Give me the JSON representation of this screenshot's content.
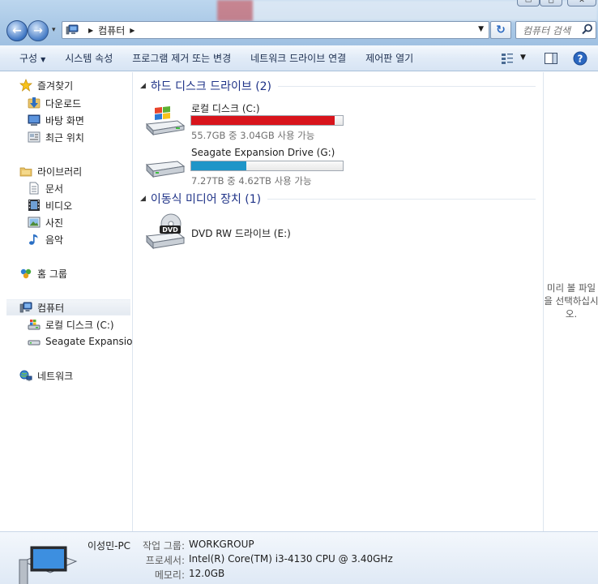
{
  "address": {
    "crumbs": [
      "컴퓨터"
    ]
  },
  "search": {
    "placeholder": "컴퓨터 검색"
  },
  "toolbar": {
    "organize": "구성",
    "system_properties": "시스템 속성",
    "uninstall": "프로그램 제거 또는 변경",
    "map_drive": "네트워크 드라이브 연결",
    "control_panel": "제어판 열기"
  },
  "nav": {
    "favorites": "즐겨찾기",
    "downloads": "다운로드",
    "desktop": "바탕 화면",
    "recent": "최근 위치",
    "libraries": "라이브러리",
    "documents": "문서",
    "videos": "비디오",
    "pictures": "사진",
    "music": "음악",
    "homegroup": "홈 그룹",
    "computer": "컴퓨터",
    "local_disk": "로컬 디스크 (C:)",
    "seagate": "Seagate Expansion I",
    "network": "네트워크"
  },
  "groups": {
    "hdd": "하드 디스크 드라이브 (2)",
    "removable": "이동식 미디어 장치 (1)"
  },
  "drives": [
    {
      "name": "로컬 디스크 (C:)",
      "free_text": "55.7GB 중 3.04GB 사용 가능",
      "used_fraction": 0.945,
      "bar_color": "#d8141c"
    },
    {
      "name": "Seagate Expansion Drive (G:)",
      "free_text": "7.27TB 중 4.62TB 사용 가능",
      "used_fraction": 0.365,
      "bar_color": "#1e95c8"
    },
    {
      "name": "DVD RW 드라이브 (E:)",
      "icon_label": "DVD"
    }
  ],
  "preview": {
    "text": "미리 볼 파일을 선택하십시오."
  },
  "details": {
    "pc_name": "이성민-PC",
    "workgroup_label": "작업 그룹:",
    "workgroup": "WORKGROUP",
    "processor_label": "프로세서:",
    "processor": "Intel(R) Core(TM) i3-4130 CPU @ 3.40GHz",
    "memory_label": "메모리:",
    "memory": "12.0GB"
  },
  "icons": [
    "back-arrow-icon",
    "forward-arrow-icon",
    "computer-icon",
    "refresh-icon",
    "search-icon",
    "view-icon",
    "preview-pane-icon",
    "help-icon",
    "star-icon",
    "folder-icon",
    "hdd-icon",
    "dvd-icon",
    "network-icon",
    "homegroup-icon"
  ]
}
